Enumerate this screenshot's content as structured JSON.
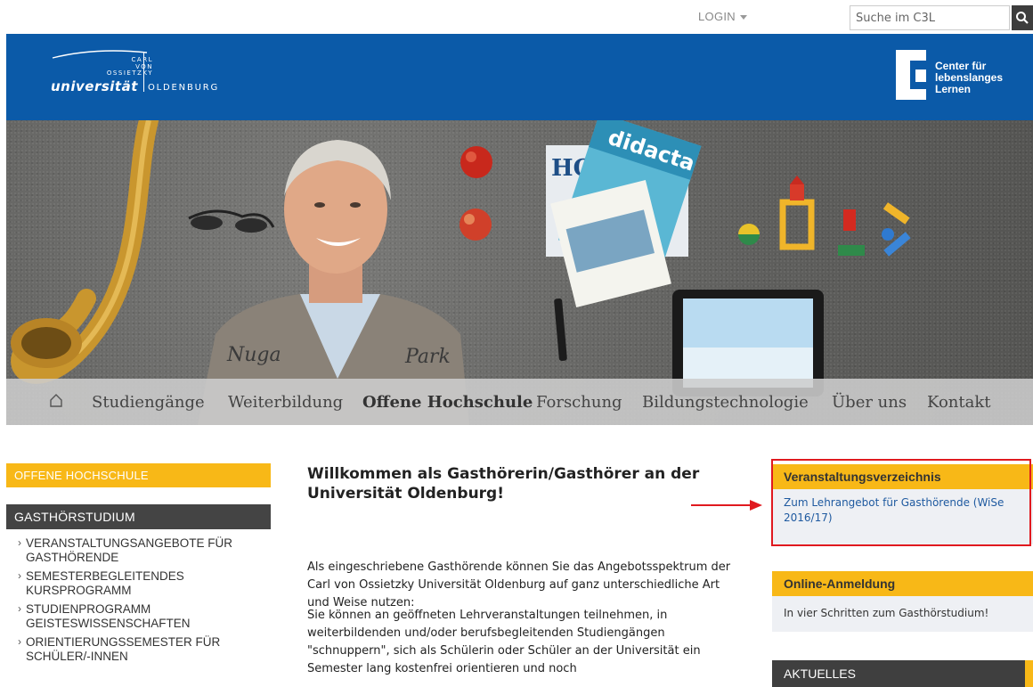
{
  "topbar": {
    "login_label": "LOGIN",
    "search_placeholder": "Suche im C3L",
    "search_button_icon": "search-icon"
  },
  "header": {
    "uni_small_lines": [
      "CARL",
      "VON",
      "OSSIETZKY"
    ],
    "uni_word": "universität",
    "uni_city": "OLDENBURG",
    "c3l_lines": [
      "Center für",
      "lebenslanges",
      "Lernen"
    ],
    "colors": {
      "blue": "#0b5aa8"
    }
  },
  "nav": {
    "home_icon": "home-icon",
    "items": [
      {
        "label": "Studiengänge",
        "active": false
      },
      {
        "label": "Weiterbildung",
        "active": false
      },
      {
        "label": "Offene Hochschule",
        "active": true
      },
      {
        "label": "Forschung",
        "active": false
      },
      {
        "label": "Bildungstechnologie",
        "active": false
      },
      {
        "label": "Über uns",
        "active": false
      },
      {
        "label": "Kontakt",
        "active": false
      }
    ]
  },
  "sidebar": {
    "section_title": "OFFENE HOCHSCHULE",
    "sub_title": "GASTHÖRSTUDIUM",
    "items": [
      {
        "label": "VERANSTALTUNGSANGEBOTE FÜR GASTHÖRENDE"
      },
      {
        "label": "SEMESTERBEGLEITENDES KURSPROGRAMM"
      },
      {
        "label": "STUDIENPROGRAMM GEISTESWISSENSCHAFTEN"
      },
      {
        "label": "ORIENTIERUNGSSEMESTER FÜR SCHÜLER/-INNEN"
      }
    ]
  },
  "main": {
    "title": "Willkommen als Gasthörerin/Gasthörer an der Universität Oldenburg!",
    "paragraphs": [
      "Als eingeschriebene Gasthörende können Sie das Angebotsspektrum der Carl von Ossietzky Universität Oldenburg auf ganz unterschiedliche Art und Weise nutzen:",
      "Sie können an geöffneten Lehrveranstaltungen teilnehmen, in weiterbildenden und/oder berufsbegleitenden Studiengängen \"schnuppern\", sich als Schülerin oder Schüler an der Universität ein Semester lang kostenfrei orientieren und noch"
    ]
  },
  "right": {
    "box1": {
      "title": "Veranstaltungsverzeichnis",
      "link": "Zum Lehrangebot für Gasthörende (WiSe 2016/17)"
    },
    "box2": {
      "title": "Online-Anmeldung",
      "text": "In vier Schritten zum Gasthörstudium!"
    },
    "box3": {
      "title": "AKTUELLES"
    },
    "colors": {
      "accent": "#f8b817",
      "highlight": "#e0191f",
      "link": "#1f5aa0"
    }
  },
  "hero": {
    "magazine_titles": [
      "HOR",
      "didacta"
    ],
    "shirt_texts": [
      "Nuga",
      "Park"
    ]
  }
}
